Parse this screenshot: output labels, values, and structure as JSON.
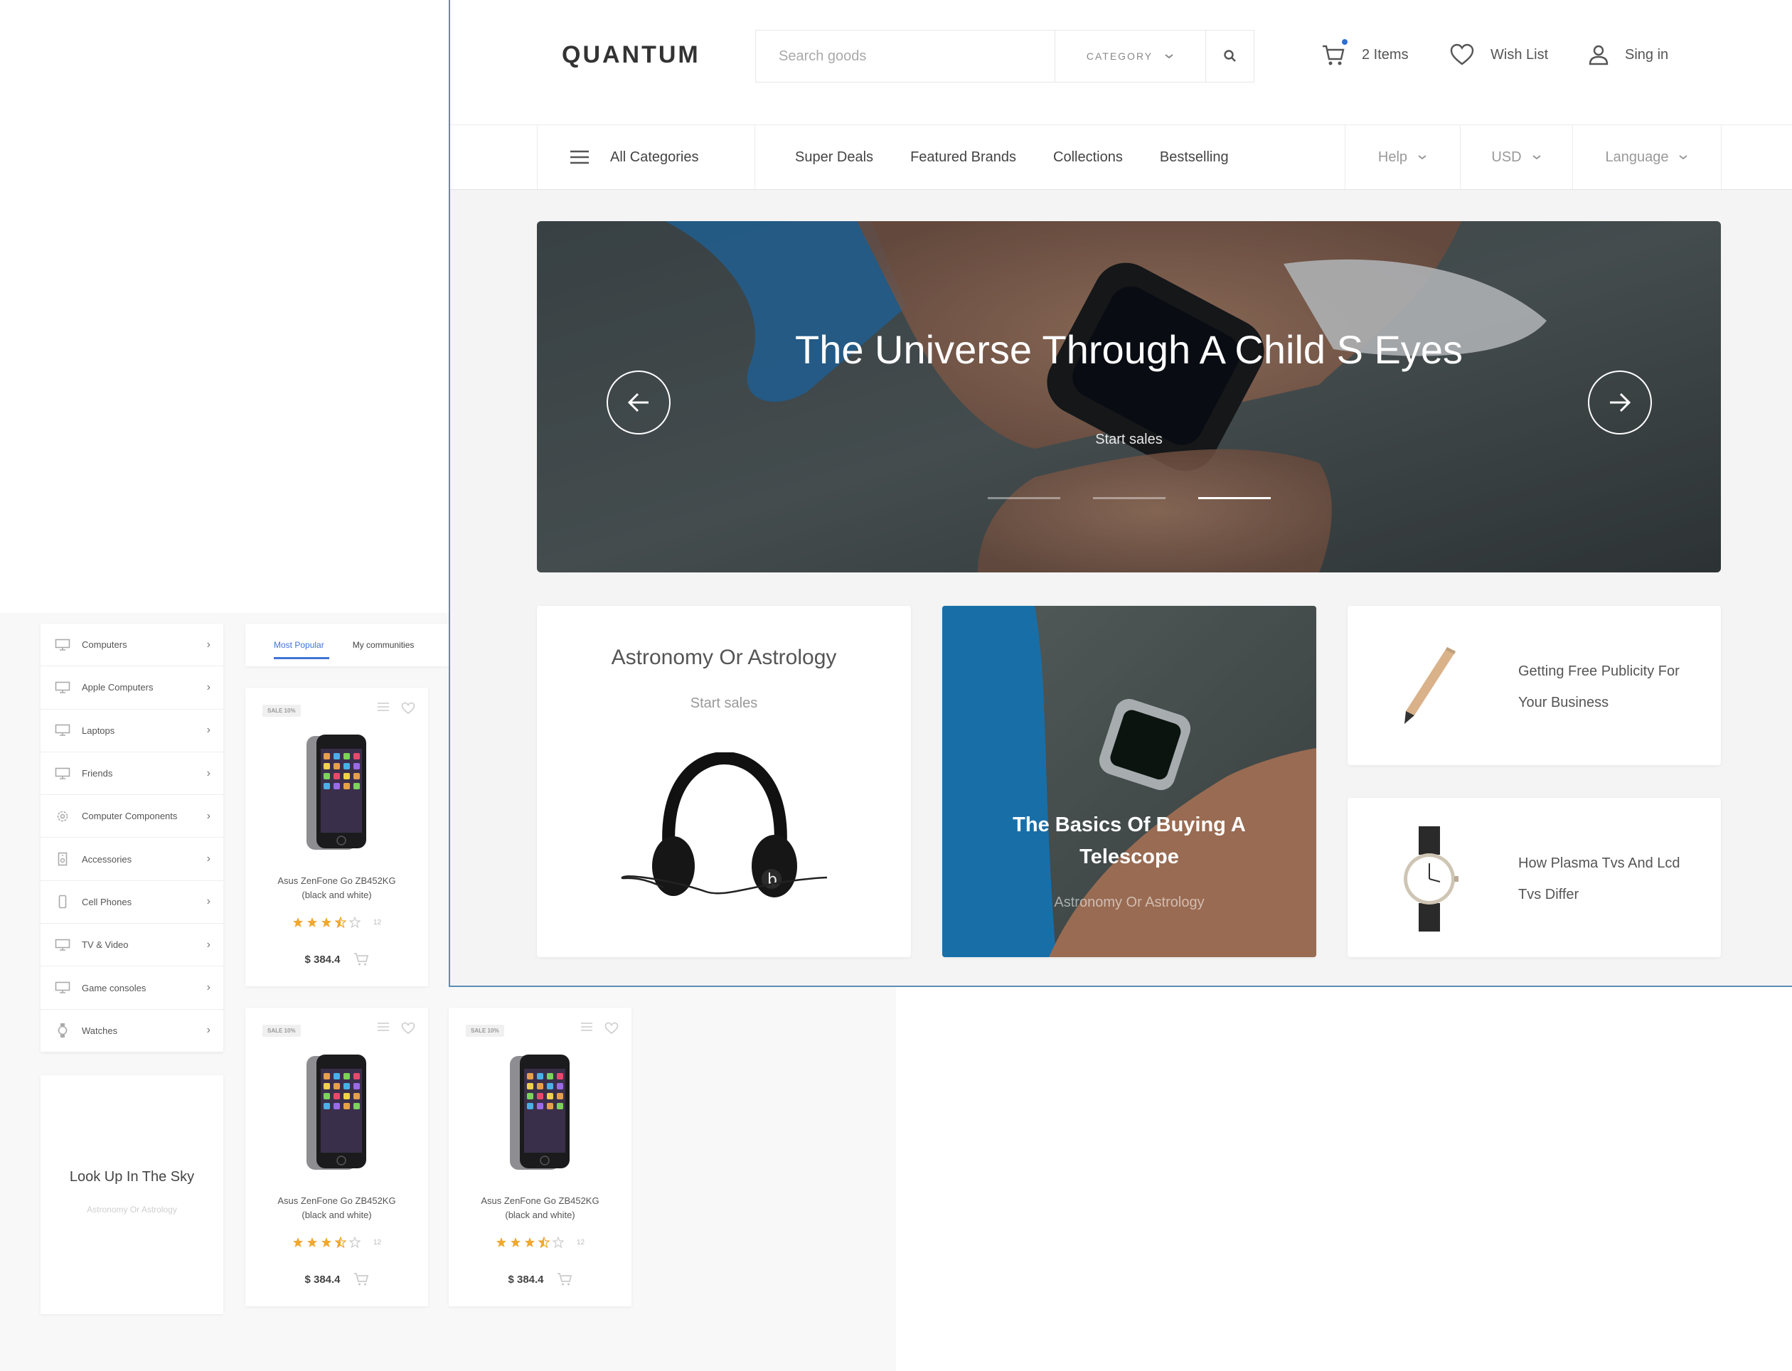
{
  "back_page": {
    "categories": [
      {
        "label": "Computers",
        "icon": "monitor-icon"
      },
      {
        "label": "Apple Computers",
        "icon": "monitor-icon"
      },
      {
        "label": "Laptops",
        "icon": "monitor-icon"
      },
      {
        "label": "Friends",
        "icon": "monitor-icon"
      },
      {
        "label": "Computer Components",
        "icon": "gear-icon"
      },
      {
        "label": "Accessories",
        "icon": "speaker-icon"
      },
      {
        "label": "Cell Phones",
        "icon": "phone-icon"
      },
      {
        "label": "TV & Video",
        "icon": "monitor-icon"
      },
      {
        "label": "Game consoles",
        "icon": "monitor-icon"
      },
      {
        "label": "Watches",
        "icon": "watch-icon"
      }
    ],
    "promo": {
      "title": "Look Up In The Sky",
      "subtitle": "Astronomy Or Astrology"
    },
    "tabs": [
      {
        "label": "Most Popular",
        "active": true
      },
      {
        "label": "My communities",
        "active": false
      }
    ],
    "products": [
      {
        "badge": "SALE 10%",
        "name_line1": "Asus ZenFone Go ZB452KG",
        "name_line2": "(black and white)",
        "rating": 3.5,
        "reviews": "12",
        "price": "$ 384.4"
      },
      {
        "badge": "SALE 10%",
        "name_line1": "Asus ZenFone Go ZB452KG",
        "name_line2": "(black and white)",
        "rating": 3.5,
        "reviews": "12",
        "price": "$ 384.4"
      },
      {
        "badge": "SALE 10%",
        "name_line1": "Asus ZenFone Go ZB452KG",
        "name_line2": "(black and white)",
        "rating": 3.5,
        "reviews": "12",
        "price": "$ 384.4"
      }
    ]
  },
  "header": {
    "logo": "QUANTUM",
    "search_placeholder": "Search goods",
    "category_label": "CATEGORY",
    "cart_label": "2 Items",
    "wishlist_label": "Wish List",
    "signin_label": "Sing in"
  },
  "nav": {
    "all_categories": "All Categories",
    "links": [
      "Super Deals",
      "Featured Brands",
      "Collections",
      "Bestselling"
    ],
    "help": "Help",
    "currency": "USD",
    "language": "Language"
  },
  "hero": {
    "title": "The Universe Through A Child S Eyes",
    "subtitle": "Start sales",
    "active_slide": 3,
    "slide_count": 3
  },
  "cards": {
    "astronomy": {
      "title": "Astronomy Or Astrology",
      "subtitle": "Start sales"
    },
    "telescope": {
      "title": "The Basics Of Buying A Telescope",
      "subtitle": "Astronomy Or Astrology"
    },
    "publicity": {
      "title": "Getting Free Publicity For Your Business"
    },
    "plasma": {
      "title": "How Plasma Tvs And Lcd Tvs Differ"
    }
  },
  "colors": {
    "accent": "#3f74d8",
    "star": "#f0a830",
    "cart_dot": "#2f6fd6",
    "frame_border": "#5b8fb5"
  }
}
